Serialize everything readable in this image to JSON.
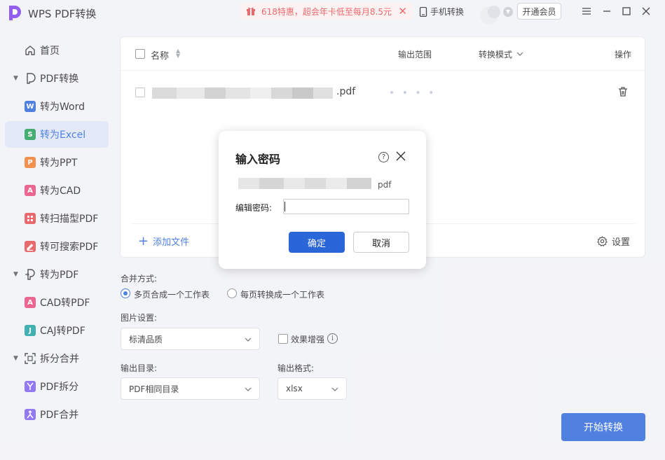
{
  "app": {
    "title": "WPS PDF转换"
  },
  "promo": {
    "text": "618特惠，超会年卡低至每月8.5元"
  },
  "header": {
    "mobile_label": "手机转换",
    "vip_label": "开通会员"
  },
  "sidebar": {
    "items": [
      {
        "label": "首页"
      },
      {
        "label": "PDF转换"
      },
      {
        "label": "转为Word",
        "badge": "W",
        "color": "#2b66d9"
      },
      {
        "label": "转为Excel",
        "badge": "S",
        "color": "#1f9d55"
      },
      {
        "label": "转为PPT",
        "badge": "P",
        "color": "#f0782a"
      },
      {
        "label": "转为CAD",
        "badge": "A",
        "color": "#e8457a"
      },
      {
        "label": "转扫描型PDF",
        "color": "#e5484d"
      },
      {
        "label": "转可搜索PDF",
        "color": "#e5484d"
      },
      {
        "label": "转为PDF"
      },
      {
        "label": "CAD转PDF",
        "badge": "A",
        "color": "#e8457a"
      },
      {
        "label": "CAJ转PDF",
        "badge": "J",
        "color": "#18a0a0"
      },
      {
        "label": "拆分合并"
      },
      {
        "label": "PDF拆分",
        "color": "#7b5cf0"
      },
      {
        "label": "PDF合并",
        "color": "#7b5cf0"
      }
    ]
  },
  "table": {
    "columns": {
      "name": "名称",
      "range": "输出范围",
      "mode": "转换模式",
      "action": "操作"
    },
    "rows": [
      {
        "ext": ".pdf",
        "range": "• • • •"
      }
    ]
  },
  "panel": {
    "add_file": "添加文件",
    "settings": "设置"
  },
  "options": {
    "merge_label": "合并方式:",
    "merge_opt1": "多页合成一个工作表",
    "merge_opt2": "每页转换成一个工作表",
    "image_label": "图片设置:",
    "image_value": "标清品质",
    "enhance_label": "效果增强",
    "output_dir_label": "输出目录:",
    "output_dir_value": "PDF相同目录",
    "output_fmt_label": "输出格式:",
    "output_fmt_value": "xlsx",
    "start_label": "开始转换"
  },
  "dialog": {
    "title": "输入密码",
    "file_ext": "pdf",
    "password_label": "编辑密码:",
    "password_value": "",
    "ok": "确定",
    "cancel": "取消"
  }
}
